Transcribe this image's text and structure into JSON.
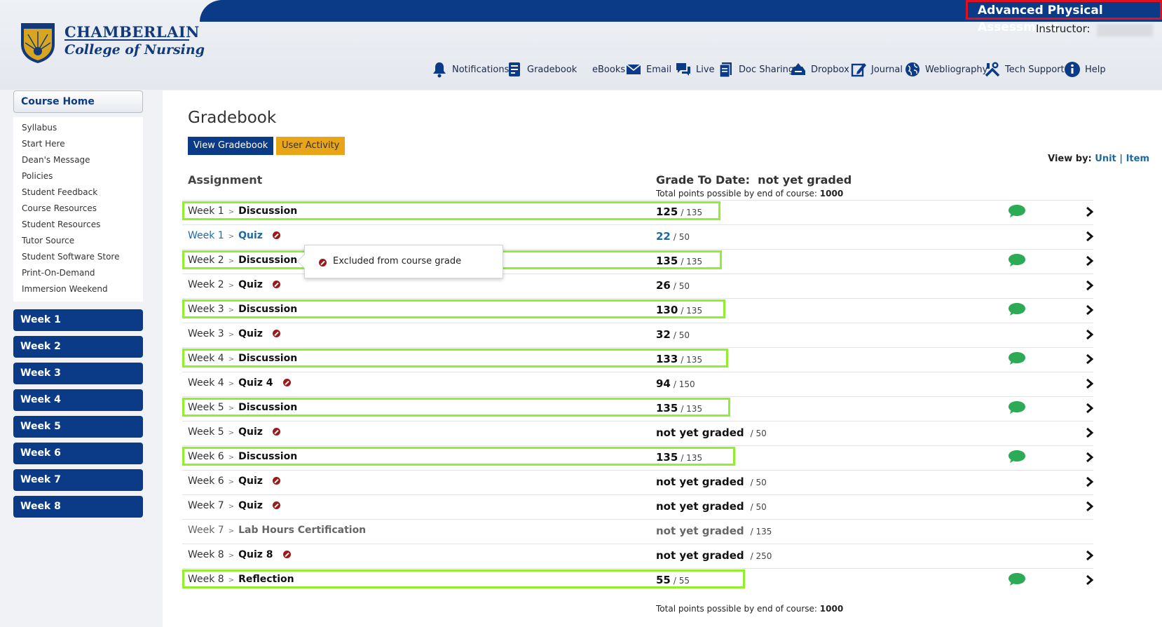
{
  "header": {
    "course_title": "Advanced Physical Assessment",
    "instructor_label": "Instructor:",
    "logo": {
      "name": "CHAMBERLAIN",
      "sub": "College of Nursing"
    }
  },
  "nav": [
    {
      "label": "Notifications",
      "icon": "bell-icon"
    },
    {
      "label": "Gradebook",
      "icon": "gradebook-icon"
    },
    {
      "label": "eBooks",
      "icon": "ebooks-icon"
    },
    {
      "label": "Email",
      "icon": "envelope-icon"
    },
    {
      "label": "Live",
      "icon": "chat-icon"
    },
    {
      "label": "Doc Sharing",
      "icon": "document-icon"
    },
    {
      "label": "Dropbox",
      "icon": "dropbox-icon"
    },
    {
      "label": "Journal",
      "icon": "journal-icon"
    },
    {
      "label": "Webliography",
      "icon": "globe-icon"
    },
    {
      "label": "Tech Support",
      "icon": "tools-icon"
    },
    {
      "label": "Help",
      "icon": "info-icon"
    }
  ],
  "sidebar": {
    "course_home": "Course Home",
    "links": [
      "Syllabus",
      "Start Here",
      "Dean's Message",
      "Policies",
      "Student Feedback",
      "Course Resources",
      "Student Resources",
      "Tutor Source",
      "Student Software Store",
      "Print-On-Demand",
      "Immersion Weekend"
    ],
    "weeks": [
      "Week 1",
      "Week 2",
      "Week 3",
      "Week 4",
      "Week 5",
      "Week 6",
      "Week 7",
      "Week 8"
    ]
  },
  "main": {
    "title": "Gradebook",
    "view_gradebook": "View Gradebook",
    "user_activity": "User Activity",
    "view_by_label": "View by:",
    "view_by_unit": "Unit",
    "view_by_sep": "|",
    "view_by_item": "Item",
    "col_assignment": "Assignment",
    "col_grade_label": "Grade To Date:",
    "col_grade_value": "not yet graded",
    "total_label": "Total points possible by end of course:",
    "total_value": "1000",
    "tooltip_text": "Excluded from course grade",
    "separator": ">",
    "rows": [
      {
        "week": "Week 1",
        "item": "Discussion",
        "grade": "125",
        "possible": "/ 135",
        "excluded": false,
        "bubble": true,
        "arrow": true,
        "highlight": true,
        "style": ""
      },
      {
        "week": "Week 1",
        "item": "Quiz",
        "grade": "22",
        "possible": "/ 50",
        "excluded": true,
        "bubble": false,
        "arrow": true,
        "highlight": false,
        "style": "link"
      },
      {
        "week": "Week 2",
        "item": "Discussion",
        "grade": "135",
        "possible": "/ 135",
        "excluded": false,
        "bubble": true,
        "arrow": true,
        "highlight": true,
        "style": ""
      },
      {
        "week": "Week 2",
        "item": "Quiz",
        "grade": "26",
        "possible": "/ 50",
        "excluded": true,
        "bubble": false,
        "arrow": true,
        "highlight": false,
        "style": ""
      },
      {
        "week": "Week 3",
        "item": "Discussion",
        "grade": "130",
        "possible": "/ 135",
        "excluded": false,
        "bubble": true,
        "arrow": true,
        "highlight": true,
        "style": ""
      },
      {
        "week": "Week 3",
        "item": "Quiz",
        "grade": "32",
        "possible": "/ 50",
        "excluded": true,
        "bubble": false,
        "arrow": true,
        "highlight": false,
        "style": ""
      },
      {
        "week": "Week 4",
        "item": "Discussion",
        "grade": "133",
        "possible": "/ 135",
        "excluded": false,
        "bubble": true,
        "arrow": true,
        "highlight": true,
        "style": ""
      },
      {
        "week": "Week 4",
        "item": "Quiz 4",
        "grade": "94",
        "possible": "/ 150",
        "excluded": true,
        "bubble": false,
        "arrow": true,
        "highlight": false,
        "style": ""
      },
      {
        "week": "Week 5",
        "item": "Discussion",
        "grade": "135",
        "possible": "/ 135",
        "excluded": false,
        "bubble": true,
        "arrow": true,
        "highlight": true,
        "style": ""
      },
      {
        "week": "Week 5",
        "item": "Quiz",
        "grade": "not yet graded",
        "possible": "/ 50",
        "excluded": true,
        "bubble": false,
        "arrow": true,
        "highlight": false,
        "style": ""
      },
      {
        "week": "Week 6",
        "item": "Discussion",
        "grade": "135",
        "possible": "/ 135",
        "excluded": false,
        "bubble": true,
        "arrow": true,
        "highlight": true,
        "style": ""
      },
      {
        "week": "Week 6",
        "item": "Quiz",
        "grade": "not yet graded",
        "possible": "/ 50",
        "excluded": true,
        "bubble": false,
        "arrow": true,
        "highlight": false,
        "style": ""
      },
      {
        "week": "Week 7",
        "item": "Quiz",
        "grade": "not yet graded",
        "possible": "/ 50",
        "excluded": true,
        "bubble": false,
        "arrow": true,
        "highlight": false,
        "style": ""
      },
      {
        "week": "Week 7",
        "item": "Lab Hours Certification",
        "grade": "not yet graded",
        "possible": "/ 135",
        "excluded": false,
        "bubble": false,
        "arrow": false,
        "highlight": false,
        "style": "muted"
      },
      {
        "week": "Week 8",
        "item": "Quiz 8",
        "grade": "not yet graded",
        "possible": "/ 250",
        "excluded": true,
        "bubble": false,
        "arrow": true,
        "highlight": false,
        "style": ""
      },
      {
        "week": "Week 8",
        "item": "Reflection",
        "grade": "55",
        "possible": "/ 55",
        "excluded": false,
        "bubble": true,
        "arrow": true,
        "highlight": true,
        "style": ""
      }
    ]
  },
  "colors": {
    "navy": "#0b3b86",
    "highlight": "#90f030",
    "bubble": "#2daa55",
    "course_title_border": "#e01020",
    "link": "#1b6aa6"
  }
}
